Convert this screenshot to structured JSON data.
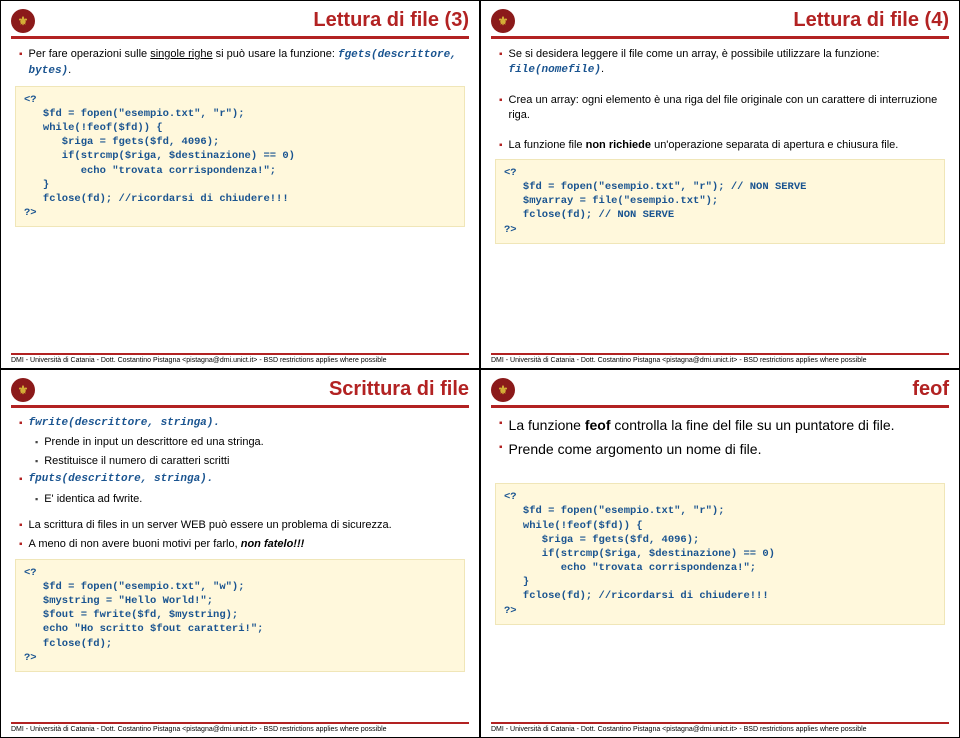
{
  "footer": "DMI - Università di Catania - Dott. Costantino Pistagna <pistagna@dmi.unict.it> - BSD restrictions applies where possible",
  "slides": {
    "s1": {
      "title": "Lettura di file (3)",
      "b1a": "Per fare operazioni sulle ",
      "b1b": "singole righe",
      "b1c": " si può usare la funzione: ",
      "b1d": "fgets(descrittore, bytes)",
      "b1e": ".",
      "code": "<?\n   $fd = fopen(\"esempio.txt\", \"r\");\n   while(!feof($fd)) {\n      $riga = fgets($fd, 4096);\n      if(strcmp($riga, $destinazione) == 0)\n         echo \"trovata corrispondenza!\";\n   }\n   fclose(fd); //ricordarsi di chiudere!!!\n?>"
    },
    "s2": {
      "title": "Lettura di file (4)",
      "b1a": "Se si desidera leggere il file come un array, è possibile utilizzare la funzione: ",
      "b1b": "file(nomefile)",
      "b1c": ".",
      "b2": "Crea un array: ogni elemento è una riga del file originale con un carattere di interruzione riga.",
      "b3a": "La funzione file ",
      "b3b": "non richiede",
      "b3c": " un'operazione separata di apertura e chiusura file.",
      "code": "<?\n   $fd = fopen(\"esempio.txt\", \"r\"); // NON SERVE\n   $myarray = file(\"esempio.txt\");\n   fclose(fd); // NON SERVE\n?>"
    },
    "s3": {
      "title": "Scrittura di file",
      "b1": "fwrite(descrittore, stringa).",
      "sb1": "Prende in input un descrittore ed una stringa.",
      "sb2": "Restituisce il numero di caratteri scritti",
      "b2": "fputs(descrittore, stringa).",
      "sb3": "E' identica ad fwrite.",
      "b3": "La scrittura di files in un server WEB può essere un problema di sicurezza.",
      "b4a": "A meno di non avere buoni motivi per farlo, ",
      "b4b": "non fatelo!!!",
      "code": "<?\n   $fd = fopen(\"esempio.txt\", \"w\");\n   $mystring = \"Hello World!\";\n   $fout = fwrite($fd, $mystring);\n   echo \"Ho scritto $fout caratteri!\";\n   fclose(fd);\n?>"
    },
    "s4": {
      "title": "feof",
      "b1a": "La funzione ",
      "b1b": "feof",
      "b1c": " controlla la fine del file su un puntatore di file.",
      "b2": "Prende come argomento un nome di file.",
      "code": "<?\n   $fd = fopen(\"esempio.txt\", \"r\");\n   while(!feof($fd)) {\n      $riga = fgets($fd, 4096);\n      if(strcmp($riga, $destinazione) == 0)\n         echo \"trovata corrispondenza!\";\n   }\n   fclose(fd); //ricordarsi di chiudere!!!\n?>"
    }
  }
}
